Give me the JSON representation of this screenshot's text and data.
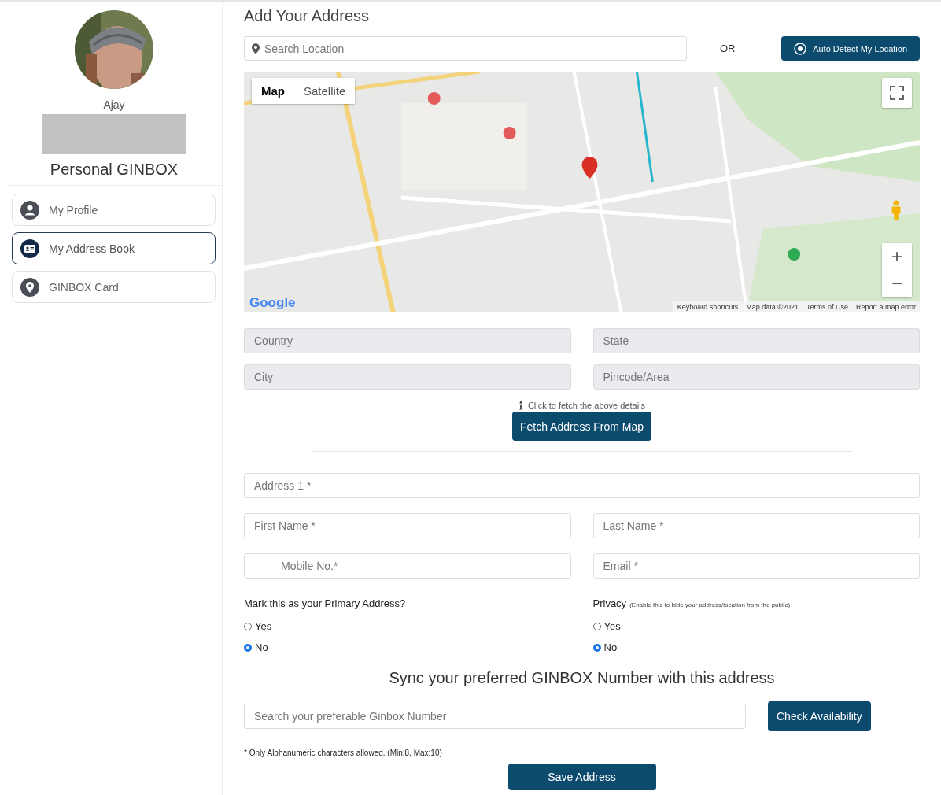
{
  "sidebar": {
    "user_name": "Ajay",
    "account_title": "Personal GINBOX",
    "nav": [
      {
        "label": "My Profile",
        "kind": "user",
        "selected": false
      },
      {
        "label": "My Address Book",
        "kind": "card",
        "selected": true
      },
      {
        "label": "GINBOX Card",
        "kind": "pin",
        "selected": false
      }
    ]
  },
  "page_title": "Add Your Address",
  "location": {
    "search_placeholder": "Search Location",
    "separator": "OR",
    "detect_button": "Auto Detect My Location"
  },
  "map": {
    "kind": "picture",
    "types": [
      {
        "label": "Map",
        "selected": true
      },
      {
        "label": "Satellite",
        "selected": false
      }
    ],
    "logo": "Google",
    "zoom_in": "+",
    "zoom_out": "−",
    "footer": [
      "Keyboard shortcuts",
      "Map data ©2021",
      "Terms of Use",
      "Report a map error"
    ]
  },
  "region_fields": [
    {
      "placeholder": "Country",
      "disabled": true
    },
    {
      "placeholder": "State",
      "disabled": true
    },
    {
      "placeholder": "City",
      "disabled": true
    },
    {
      "placeholder": "Pincode/Area",
      "disabled": true
    }
  ],
  "fetch": {
    "hint": "Click to fetch the above details",
    "button": "Fetch Address From Map"
  },
  "contact_fields": [
    {
      "placeholder": "Address 1 *",
      "kind": "wide"
    },
    {
      "placeholder": "First Name *",
      "kind": "half"
    },
    {
      "placeholder": "Last Name *",
      "kind": "half"
    },
    {
      "placeholder": "Mobile No.*",
      "kind": "phone"
    },
    {
      "placeholder": "Email *",
      "kind": "half"
    }
  ],
  "radio_groups": [
    {
      "label": "Mark this as your Primary Address?",
      "options": [
        {
          "label": "Yes",
          "selected": false
        },
        {
          "label": "No",
          "selected": true
        }
      ]
    },
    {
      "label": "Privacy",
      "note": "(Enable this to hide your address/location from the public)",
      "options": [
        {
          "label": "Yes",
          "selected": false
        },
        {
          "label": "No",
          "selected": true
        }
      ]
    }
  ],
  "sync": {
    "title": "Sync your preferred GINBOX Number with this address",
    "placeholder": "Search your preferable Ginbox Number",
    "button": "Check Availability",
    "note": "* Only Alphanumeric characters allowed. (Min:8, Max:10)"
  },
  "save_button": "Save Address"
}
